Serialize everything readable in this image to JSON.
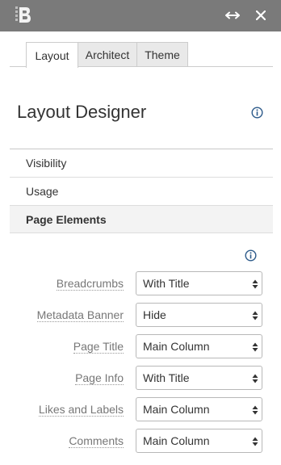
{
  "tabs": [
    {
      "label": "Layout",
      "active": true
    },
    {
      "label": "Architect",
      "active": false
    },
    {
      "label": "Theme",
      "active": false
    }
  ],
  "title": "Layout Designer",
  "sections": [
    {
      "label": "Visibility"
    },
    {
      "label": "Usage"
    },
    {
      "label": "Page Elements",
      "active": true
    }
  ],
  "page_elements": [
    {
      "label": "Breadcrumbs",
      "value": "With Title"
    },
    {
      "label": "Metadata Banner",
      "value": "Hide"
    },
    {
      "label": "Page Title",
      "value": "Main Column"
    },
    {
      "label": "Page Info",
      "value": "With Title"
    },
    {
      "label": "Likes and Labels",
      "value": "Main Column"
    },
    {
      "label": "Comments",
      "value": "Main Column"
    }
  ],
  "colors": {
    "topbar": "#7a7a7a",
    "info_icon": "#2c5a8a"
  },
  "icons": [
    "b-logo-icon",
    "expand-horizontal-icon",
    "close-icon",
    "info-icon",
    "select-caret-icon"
  ]
}
